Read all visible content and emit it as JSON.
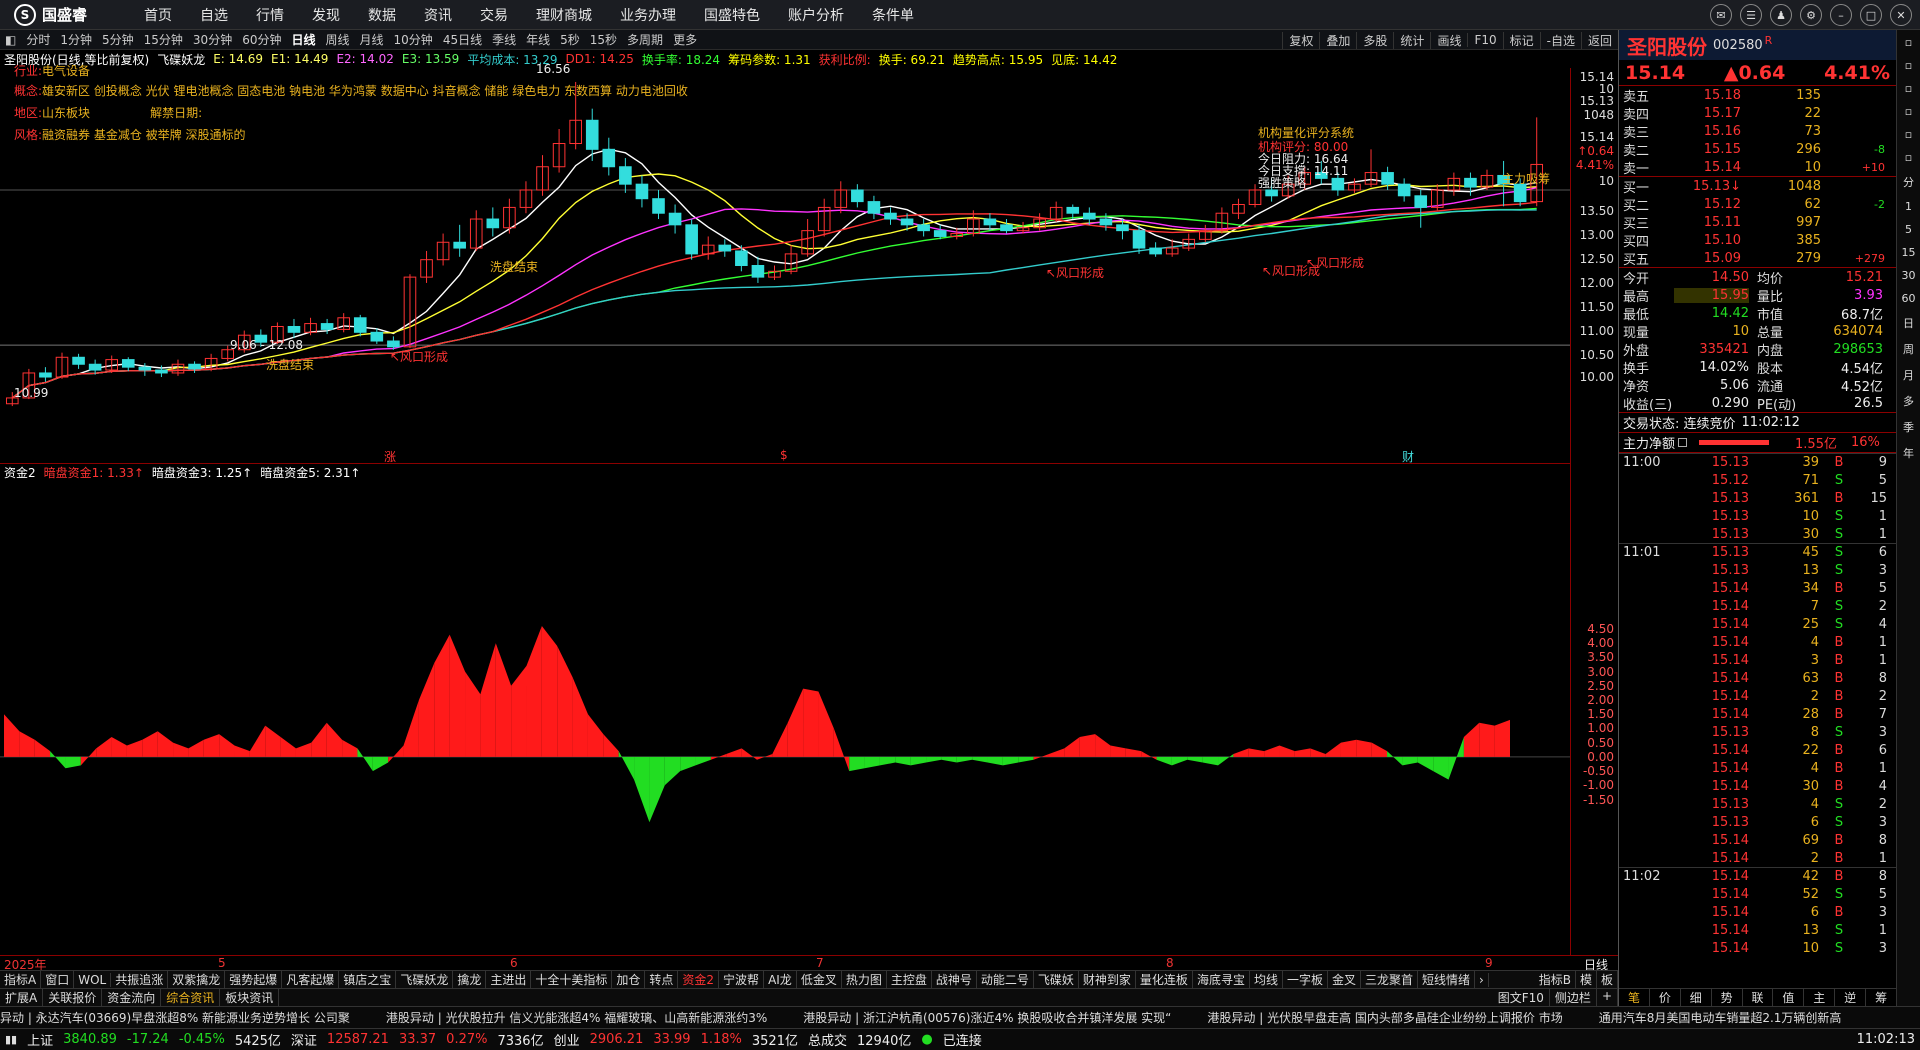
{
  "app": {
    "logo": "国盛睿"
  },
  "menu": [
    "首页",
    "自选",
    "行情",
    "发现",
    "数据",
    "资讯",
    "交易",
    "理财商城",
    "业务办理",
    "国盛特色",
    "账户分析",
    "条件单"
  ],
  "periods": [
    "分时",
    "1分钟",
    "5分钟",
    "15分钟",
    "30分钟",
    "60分钟",
    "日线",
    "周线",
    "月线",
    "10分钟",
    "45日线",
    "季线",
    "年线",
    "5秒",
    "15秒",
    "多周期",
    "更多"
  ],
  "active_period": "日线",
  "tools": [
    "复权",
    "叠加",
    "多股",
    "统计",
    "画线",
    "F10",
    "标记",
    "-自选",
    "返回"
  ],
  "chart_info": [
    {
      "text": "圣阳股份(日线,等比前复权)",
      "color": "#ffffff"
    },
    {
      "text": "飞碟妖龙",
      "color": "#ffffff"
    },
    {
      "text": "E: 14.69",
      "color": "#ffff66"
    },
    {
      "text": "E1: 14.49",
      "color": "#ffff66"
    },
    {
      "text": "E2: 14.02",
      "color": "#ff66ff"
    },
    {
      "text": "E3: 13.59",
      "color": "#66ff66"
    },
    {
      "text": "平均成本: 13.29",
      "color": "#33cccc"
    },
    {
      "text": "DD1: 14.25",
      "color": "#ff3333"
    },
    {
      "text": "换手率: 18.24",
      "color": "#33ff33"
    },
    {
      "text": "筹码参数: 1.31",
      "color": "#ffff00"
    },
    {
      "text": "获利比例:",
      "color": "#ff3333"
    },
    {
      "text": "换手: 69.21",
      "color": "#ffff00"
    },
    {
      "text": "趋势高点: 15.95",
      "color": "#ffff00"
    },
    {
      "text": "见底: 14.42",
      "color": "#ffff00"
    }
  ],
  "stock_info": {
    "industry_label": "行业:",
    "industry": "电气设备",
    "concept_label": "概念:",
    "concept": "雄安新区 创投概念 光伏 锂电池概念 固态电池 钠电池 华为鸿蒙 数据中心 抖音概念 储能 绿色电力 东数西算 动力电池回收",
    "region_label": "地区:",
    "region": "山东板块",
    "unlock_label": "解禁日期:",
    "style_label": "风格:",
    "style": "融资融券 基金减仓 被举牌 深股通标的"
  },
  "chart_annotations": {
    "high": "16.56",
    "low": "10.99",
    "range": "9.06 - 12.08",
    "wash1": "洗盘结束",
    "wash2": "洗盘结束",
    "wind1": "↖风口形成",
    "wind2": "↖风口形成",
    "wind3": "↖风口形成",
    "wind4": "↖风口形成",
    "main_buy": "主力吸筹",
    "inst_title": "机构量化评分系统",
    "inst_score": "机构评分: 80.00",
    "resistance": "今日阻力: 16.64",
    "support": "今日支撑: 14.11",
    "advice": "强胜策略",
    "markers": [
      "涨",
      "$",
      "财"
    ]
  },
  "main_y_ticks": [
    "15.14",
    "10",
    "15.13",
    "1048",
    "15.14",
    "↑0.64",
    "4.41%",
    "10",
    "13.50",
    "13.00",
    "12.50",
    "12.00",
    "11.50",
    "11.00",
    "10.50",
    "10.00"
  ],
  "sub_info": [
    {
      "text": "资金2",
      "color": "#ffffff"
    },
    {
      "text": "暗盘资金1: 1.33↑",
      "color": "#ff3333"
    },
    {
      "text": "暗盘资金3: 1.25↑",
      "color": "#ffffff"
    },
    {
      "text": "暗盘资金5: 2.31↑",
      "color": "#ffffff"
    }
  ],
  "sub_y_ticks": [
    "4.50",
    "4.00",
    "3.50",
    "3.00",
    "2.50",
    "2.00",
    "1.50",
    "1.00",
    "0.50",
    "0.00",
    "-0.50",
    "-1.00",
    "-1.50"
  ],
  "date_labels": [
    "2025年",
    "5",
    "6",
    "7",
    "8",
    "9"
  ],
  "date_period": "日线",
  "indicator_tabs": [
    "指标A",
    "窗口",
    "WOL",
    "共振追涨",
    "双紫擒龙",
    "强势起爆",
    "凡客起爆",
    "镇店之宝",
    "飞碟妖龙",
    "擒龙",
    "主进出",
    "十全十美指标",
    "加仓",
    "转点",
    "资金2",
    "宁波帮",
    "AI龙",
    "低金叉",
    "热力图",
    "主控盘",
    "战神号",
    "动能二号",
    "飞碟妖",
    "财神到家",
    "量化连板",
    "海底寻宝",
    "均线",
    "一字板",
    "金叉",
    "三龙聚首",
    "短线情绪"
  ],
  "indicator_active": "资金2",
  "indicator_right": [
    "指标B",
    "模",
    "板"
  ],
  "bottom_tabs": [
    "扩展A",
    "关联报价",
    "资金流向",
    "综合资讯",
    "板块资讯"
  ],
  "bottom_active": "综合资讯",
  "bottom_right": [
    "图文F10",
    "侧边栏",
    "+"
  ],
  "ticker": [
    "异动 | 永达汽车(03669)早盘涨超8% 新能源业务逆势增长 公司聚",
    "港股异动 | 光伏股拉升 信义光能涨超4% 福耀玻璃、山高新能源涨约3%",
    "港股异动 | 浙江沪杭甬(00576)涨近4% 换股吸收合并镇洋发展 实现“",
    "港股异动 | 光伏股早盘走高 国内头部多晶硅企业纷纷上调报价 市场",
    "通用汽车8月美国电动车销量超2.1万辆创新高"
  ],
  "status": {
    "sh_label": "上证",
    "sh": "3840.89",
    "sh_chg": "-17.24",
    "sh_pct": "-0.45%",
    "sh_amt": "5425亿",
    "sz_label": "深证",
    "sz": "12587.21",
    "sz_chg": "33.37",
    "sz_pct": "0.27%",
    "sz_amt": "7336亿",
    "cy_label": "创业",
    "cy": "2906.21",
    "cy_chg": "33.99",
    "cy_pct": "1.18%",
    "cy_amt": "3521亿",
    "total_label": "总成交",
    "total": "12940亿",
    "conn": "已连接",
    "time": "11:02:13"
  },
  "quote": {
    "name": "圣阳股份",
    "code": "002580",
    "flag": "R",
    "price": "15.14",
    "change": "▲0.64",
    "pct": "4.41%",
    "asks": [
      {
        "label": "卖五",
        "price": "15.18",
        "vol": "135",
        "chg": ""
      },
      {
        "label": "卖四",
        "price": "15.17",
        "vol": "22",
        "chg": ""
      },
      {
        "label": "卖三",
        "price": "15.16",
        "vol": "73",
        "chg": ""
      },
      {
        "label": "卖二",
        "price": "15.15",
        "vol": "296",
        "chg": "-8"
      },
      {
        "label": "卖一",
        "price": "15.14",
        "vol": "10",
        "chg": "+10"
      }
    ],
    "bids": [
      {
        "label": "买一",
        "price": "15.13↓",
        "vol": "1048",
        "chg": ""
      },
      {
        "label": "买二",
        "price": "15.12",
        "vol": "62",
        "chg": "-2"
      },
      {
        "label": "买三",
        "price": "15.11",
        "vol": "997",
        "chg": ""
      },
      {
        "label": "买四",
        "price": "15.10",
        "vol": "385",
        "chg": ""
      },
      {
        "label": "买五",
        "price": "15.09",
        "vol": "279",
        "chg": "+279"
      }
    ],
    "stats": [
      [
        "今开",
        "14.50",
        "均价",
        "15.21"
      ],
      [
        "最高",
        "15.95",
        "量比",
        "3.93"
      ],
      [
        "最低",
        "14.42",
        "市值",
        "68.7亿"
      ],
      [
        "现量",
        "10",
        "总量",
        "634074"
      ],
      [
        "外盘",
        "335421",
        "内盘",
        "298653"
      ],
      [
        "换手",
        "14.02%",
        "股本",
        "4.54亿"
      ],
      [
        "净资",
        "5.06",
        "流通",
        "4.52亿"
      ],
      [
        "收益(三)",
        "0.290",
        "PE(动)",
        "26.5"
      ]
    ],
    "trade_status": "交易状态: 连续竞价",
    "trade_time": "11:02:12",
    "main_net_label": "主力净额",
    "main_net": "1.55亿",
    "main_net_pct": "16%",
    "ticks": [
      {
        "t": "11:00",
        "p": "15.13",
        "v": "39",
        "s": "B",
        "n": "9"
      },
      {
        "t": "",
        "p": "15.12",
        "v": "71",
        "s": "S",
        "n": "5"
      },
      {
        "t": "",
        "p": "15.13",
        "v": "361",
        "s": "B",
        "n": "15"
      },
      {
        "t": "",
        "p": "15.13",
        "v": "10",
        "s": "S",
        "n": "1"
      },
      {
        "t": "",
        "p": "15.13",
        "v": "30",
        "s": "S",
        "n": "1"
      },
      {
        "t": "11:01",
        "p": "15.13",
        "v": "45",
        "s": "S",
        "n": "6"
      },
      {
        "t": "",
        "p": "15.13",
        "v": "13",
        "s": "S",
        "n": "3"
      },
      {
        "t": "",
        "p": "15.14",
        "v": "34",
        "s": "B",
        "n": "5"
      },
      {
        "t": "",
        "p": "15.14",
        "v": "7",
        "s": "S",
        "n": "2"
      },
      {
        "t": "",
        "p": "15.14",
        "v": "25",
        "s": "S",
        "n": "4"
      },
      {
        "t": "",
        "p": "15.14",
        "v": "4",
        "s": "B",
        "n": "1"
      },
      {
        "t": "",
        "p": "15.14",
        "v": "3",
        "s": "B",
        "n": "1"
      },
      {
        "t": "",
        "p": "15.14",
        "v": "63",
        "s": "B",
        "n": "8"
      },
      {
        "t": "",
        "p": "15.14",
        "v": "2",
        "s": "B",
        "n": "2"
      },
      {
        "t": "",
        "p": "15.14",
        "v": "28",
        "s": "B",
        "n": "7"
      },
      {
        "t": "",
        "p": "15.13",
        "v": "8",
        "s": "S",
        "n": "3"
      },
      {
        "t": "",
        "p": "15.14",
        "v": "22",
        "s": "B",
        "n": "6"
      },
      {
        "t": "",
        "p": "15.14",
        "v": "4",
        "s": "B",
        "n": "1"
      },
      {
        "t": "",
        "p": "15.14",
        "v": "30",
        "s": "B",
        "n": "4"
      },
      {
        "t": "",
        "p": "15.13",
        "v": "4",
        "s": "S",
        "n": "2"
      },
      {
        "t": "",
        "p": "15.13",
        "v": "6",
        "s": "S",
        "n": "3"
      },
      {
        "t": "",
        "p": "15.14",
        "v": "69",
        "s": "B",
        "n": "8"
      },
      {
        "t": "",
        "p": "15.14",
        "v": "2",
        "s": "B",
        "n": "1"
      },
      {
        "t": "11:02",
        "p": "15.14",
        "v": "42",
        "s": "B",
        "n": "8"
      },
      {
        "t": "",
        "p": "15.14",
        "v": "52",
        "s": "S",
        "n": "5"
      },
      {
        "t": "",
        "p": "15.14",
        "v": "6",
        "s": "B",
        "n": "3"
      },
      {
        "t": "",
        "p": "15.14",
        "v": "13",
        "s": "S",
        "n": "1"
      },
      {
        "t": "",
        "p": "15.14",
        "v": "10",
        "s": "S",
        "n": "3"
      }
    ],
    "panel_tabs": [
      "笔",
      "价",
      "细",
      "势",
      "联",
      "值",
      "主",
      "逆",
      "筹"
    ]
  },
  "sidebar_labels": [
    "分",
    "1",
    "5",
    "15",
    "30",
    "60",
    "日",
    "周",
    "月",
    "多",
    "季",
    "年"
  ],
  "chart_data": {
    "type": "candlestick",
    "ylim": [
      10.0,
      16.8
    ],
    "candles": [
      [
        11.02,
        11.12,
        10.98,
        11.22
      ],
      [
        11.12,
        11.55,
        11.1,
        11.62
      ],
      [
        11.55,
        11.48,
        11.4,
        11.65
      ],
      [
        11.48,
        11.82,
        11.45,
        11.9
      ],
      [
        11.82,
        11.7,
        11.62,
        11.88
      ],
      [
        11.7,
        11.6,
        11.52,
        11.78
      ],
      [
        11.6,
        11.78,
        11.55,
        11.85
      ],
      [
        11.78,
        11.65,
        11.58,
        11.82
      ],
      [
        11.65,
        11.6,
        11.5,
        11.72
      ],
      [
        11.6,
        11.55,
        11.48,
        11.68
      ],
      [
        11.55,
        11.7,
        11.5,
        11.78
      ],
      [
        11.7,
        11.62,
        11.55,
        11.75
      ],
      [
        11.62,
        11.8,
        11.58,
        11.88
      ],
      [
        11.8,
        11.95,
        11.75,
        12.02
      ],
      [
        11.95,
        12.2,
        11.9,
        12.28
      ],
      [
        12.2,
        12.08,
        12.0,
        12.3
      ],
      [
        12.08,
        12.35,
        12.05,
        12.42
      ],
      [
        12.35,
        12.25,
        12.15,
        12.48
      ],
      [
        12.25,
        12.4,
        12.2,
        12.5
      ],
      [
        12.4,
        12.3,
        12.22,
        12.48
      ],
      [
        12.3,
        12.5,
        12.25,
        12.58
      ],
      [
        12.5,
        12.25,
        12.18,
        12.55
      ],
      [
        12.25,
        12.1,
        12.05,
        12.32
      ],
      [
        12.1,
        12.0,
        11.95,
        12.18
      ],
      [
        12.0,
        13.2,
        11.98,
        13.25
      ],
      [
        13.2,
        13.5,
        13.1,
        13.65
      ],
      [
        13.5,
        13.8,
        13.4,
        13.95
      ],
      [
        13.8,
        13.7,
        13.55,
        14.1
      ],
      [
        13.7,
        14.2,
        13.65,
        14.35
      ],
      [
        14.2,
        14.05,
        13.9,
        14.4
      ],
      [
        14.05,
        14.4,
        13.95,
        14.55
      ],
      [
        14.4,
        14.7,
        14.3,
        14.85
      ],
      [
        14.7,
        15.1,
        14.6,
        15.3
      ],
      [
        15.1,
        15.5,
        15.0,
        15.75
      ],
      [
        15.5,
        15.9,
        15.4,
        16.56
      ],
      [
        15.9,
        15.4,
        15.2,
        16.1
      ],
      [
        15.4,
        15.1,
        14.95,
        15.6
      ],
      [
        15.1,
        14.8,
        14.65,
        15.25
      ],
      [
        14.8,
        14.55,
        14.4,
        14.95
      ],
      [
        14.55,
        14.3,
        14.2,
        14.7
      ],
      [
        14.3,
        14.1,
        13.95,
        14.45
      ],
      [
        14.1,
        13.6,
        13.5,
        14.2
      ],
      [
        13.6,
        13.75,
        13.5,
        13.9
      ],
      [
        13.75,
        13.65,
        13.55,
        13.85
      ],
      [
        13.65,
        13.4,
        13.3,
        13.75
      ],
      [
        13.4,
        13.2,
        13.1,
        13.55
      ],
      [
        13.2,
        13.3,
        13.15,
        13.4
      ],
      [
        13.3,
        13.6,
        13.25,
        13.75
      ],
      [
        13.6,
        14.0,
        13.55,
        14.2
      ],
      [
        14.0,
        14.4,
        13.9,
        14.55
      ],
      [
        14.4,
        14.7,
        14.3,
        14.85
      ],
      [
        14.7,
        14.5,
        14.4,
        14.8
      ],
      [
        14.5,
        14.3,
        14.2,
        14.6
      ],
      [
        14.3,
        14.2,
        14.1,
        14.4
      ],
      [
        14.2,
        14.1,
        14.0,
        14.3
      ],
      [
        14.1,
        14.0,
        13.9,
        14.2
      ],
      [
        14.0,
        13.9,
        13.85,
        14.1
      ],
      [
        13.9,
        13.95,
        13.85,
        14.05
      ],
      [
        13.95,
        14.2,
        13.9,
        14.35
      ],
      [
        14.2,
        14.1,
        14.0,
        14.3
      ],
      [
        14.1,
        14.0,
        13.95,
        14.2
      ],
      [
        14.0,
        14.05,
        13.95,
        14.15
      ],
      [
        14.05,
        14.2,
        14.0,
        14.3
      ],
      [
        14.2,
        14.4,
        14.15,
        14.5
      ],
      [
        14.4,
        14.3,
        14.2,
        14.45
      ],
      [
        14.3,
        14.2,
        14.1,
        14.4
      ],
      [
        14.2,
        14.1,
        14.0,
        14.3
      ],
      [
        14.1,
        14.0,
        13.85,
        14.2
      ],
      [
        14.0,
        13.7,
        13.6,
        14.1
      ],
      [
        13.7,
        13.6,
        13.55,
        13.8
      ],
      [
        13.6,
        13.7,
        13.55,
        13.85
      ],
      [
        13.7,
        13.85,
        13.65,
        13.95
      ],
      [
        13.85,
        14.0,
        13.8,
        14.1
      ],
      [
        14.0,
        14.3,
        13.95,
        14.4
      ],
      [
        14.3,
        14.45,
        14.2,
        14.55
      ],
      [
        14.45,
        14.7,
        14.4,
        14.8
      ],
      [
        14.7,
        14.6,
        14.5,
        14.9
      ],
      [
        14.6,
        14.8,
        14.55,
        14.95
      ],
      [
        14.8,
        15.0,
        14.7,
        15.1
      ],
      [
        15.0,
        14.9,
        14.8,
        15.2
      ],
      [
        14.9,
        14.7,
        14.6,
        15.0
      ],
      [
        14.7,
        14.8,
        14.65,
        14.9
      ],
      [
        14.8,
        15.0,
        14.75,
        15.4
      ],
      [
        15.0,
        14.8,
        14.7,
        15.1
      ],
      [
        14.8,
        14.6,
        14.5,
        14.9
      ],
      [
        14.6,
        14.4,
        14.05,
        14.7
      ],
      [
        14.4,
        14.7,
        14.35,
        14.8
      ],
      [
        14.7,
        14.9,
        14.6,
        15.0
      ],
      [
        14.9,
        14.75,
        14.6,
        15.0
      ],
      [
        14.75,
        14.95,
        14.7,
        15.05
      ],
      [
        14.95,
        14.8,
        14.42,
        15.2
      ],
      [
        14.8,
        14.5,
        14.42,
        14.9
      ],
      [
        14.5,
        15.14,
        14.42,
        15.95
      ]
    ],
    "sub_values": [
      1.5,
      0.9,
      0.6,
      0.2,
      -0.4,
      -0.3,
      0.3,
      0.7,
      0.4,
      0.6,
      0.9,
      0.5,
      0.3,
      0.6,
      0.8,
      0.4,
      0.2,
      1.1,
      0.7,
      0.3,
      0.5,
      1.2,
      0.6,
      0.3,
      -0.5,
      -0.2,
      0.4,
      2.0,
      3.3,
      4.3,
      3.0,
      2.2,
      4.0,
      2.5,
      3.2,
      4.6,
      3.9,
      2.8,
      1.5,
      0.8,
      0.2,
      -0.8,
      -2.3,
      -1.0,
      -0.5,
      -0.3,
      -0.1,
      0.1,
      0.3,
      -0.1,
      0.1,
      1.2,
      2.4,
      2.3,
      1.0,
      -0.5,
      -0.4,
      -0.3,
      -0.2,
      -0.3,
      -0.2,
      -0.1,
      -0.2,
      -0.1,
      -0.2,
      -0.3,
      -0.2,
      -0.1,
      0.1,
      0.3,
      0.7,
      0.8,
      0.4,
      0.3,
      0.2,
      -0.1,
      -0.3,
      -0.1,
      -0.2,
      -0.3,
      0.1,
      0.3,
      0.2,
      0.4,
      0.2,
      0.3,
      0.1,
      0.5,
      0.6,
      0.5,
      0.2,
      -0.3,
      -0.2,
      -0.5,
      -0.8,
      0.7,
      1.2,
      1.1,
      1.3
    ]
  }
}
